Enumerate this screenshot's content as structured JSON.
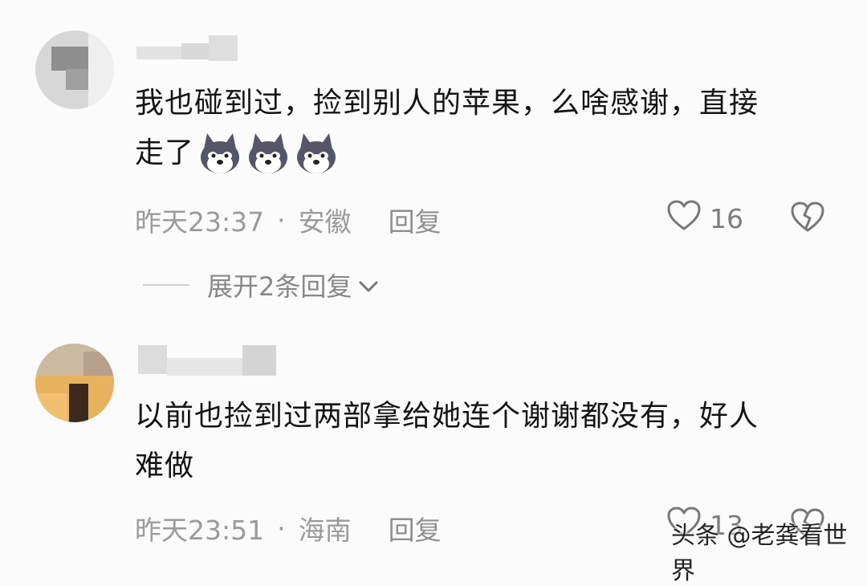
{
  "comments": [
    {
      "line1": "我也碰到过，捡到别人的苹果，么啥感谢，直接",
      "line2": "走了",
      "emoji": "husky-dog-emoji",
      "time": "昨天23:37",
      "dot": "·",
      "location": "安徽",
      "reply": "回复",
      "likes": "16"
    },
    {
      "line1": "以前也捡到过两部拿给她连个谢谢都没有，好人",
      "line2": "难做",
      "time": "昨天23:51",
      "dot": "·",
      "location": "海南",
      "reply": "回复",
      "likes": "13"
    }
  ],
  "expand_label": "展开2条回复",
  "watermark": "头条 @老龚看世界"
}
